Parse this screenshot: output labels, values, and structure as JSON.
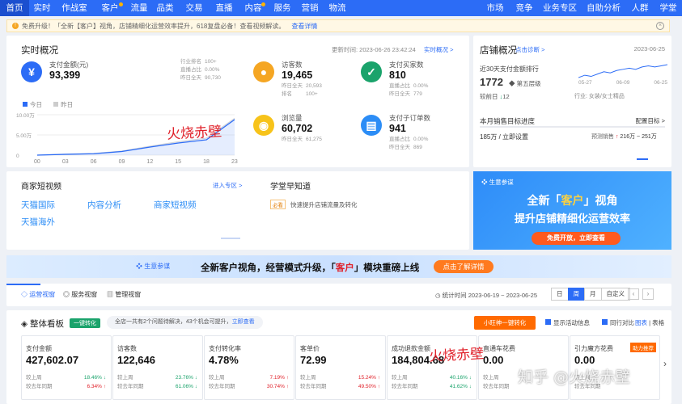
{
  "nav": {
    "items": [
      {
        "label": "首页",
        "dot": false
      },
      {
        "label": "实时",
        "dot": false
      },
      {
        "label": "作战室",
        "dot": false
      },
      {
        "label": "客户",
        "dot": true
      },
      {
        "label": "流量",
        "dot": false
      },
      {
        "label": "品类",
        "dot": false
      },
      {
        "label": "交易",
        "dot": false
      },
      {
        "label": "直播",
        "dot": false
      },
      {
        "label": "内容",
        "dot": true
      },
      {
        "label": "服务",
        "dot": false
      },
      {
        "label": "营销",
        "dot": false
      },
      {
        "label": "物流",
        "dot": false
      },
      {
        "label": "市场",
        "dot": false
      },
      {
        "label": "竞争",
        "dot": false
      },
      {
        "label": "业务专区",
        "dot": false
      },
      {
        "label": "自助分析",
        "dot": false
      },
      {
        "label": "人群",
        "dot": false
      },
      {
        "label": "学堂",
        "dot": false
      }
    ]
  },
  "alert": {
    "icon": "!",
    "text": "免费升级！「全新【客户】视角，店铺精细化运营效率提升，618复盘必备！查看视频解读。",
    "link": "查看详情",
    "close": "×"
  },
  "realtime": {
    "title": "实时概况",
    "update_time": "更新时间: 2023-06-26 23:42:24",
    "link": "实时概况 >",
    "metrics": [
      {
        "icon": "¥",
        "label": "支付金额(元)",
        "value": "93,399",
        "color": "#2c6cf6",
        "rows": [
          [
            "行业排名",
            "100+"
          ],
          [
            "直播占比",
            "0.00%"
          ],
          [
            "昨日全天",
            "90,730"
          ]
        ]
      },
      {
        "icon": "●",
        "label": "访客数",
        "value": "19,465",
        "color": "#f5a623",
        "rows": [
          [
            "昨日全天",
            "20,593"
          ],
          [
            "排名",
            "100+"
          ]
        ]
      },
      {
        "icon": "✓",
        "label": "支付买家数",
        "value": "810",
        "color": "#1aa36b",
        "rows": [
          [
            "直播占比",
            "0.00%"
          ],
          [
            "昨日全天",
            "779"
          ]
        ]
      },
      {
        "icon": "◉",
        "label": "浏览量",
        "value": "60,702",
        "color": "#f7c31a",
        "rows": [
          [
            "昨日全天",
            "61,275"
          ]
        ]
      },
      {
        "icon": "▤",
        "label": "支付子订单数",
        "value": "941",
        "color": "#2c8df6",
        "rows": [
          [
            "直播占比",
            "0.00%"
          ],
          [
            "昨日全天",
            "869"
          ]
        ]
      }
    ],
    "legend": {
      "today": "今日",
      "yesterday": "昨日"
    }
  },
  "chart_data": {
    "type": "line",
    "title": "",
    "xlabel": "",
    "ylabel": "",
    "categories": [
      "00",
      "03",
      "06",
      "09",
      "12",
      "15",
      "18",
      "23"
    ],
    "y_ticks": [
      "10.00万",
      "5.00万",
      "0"
    ],
    "ylim": [
      0,
      100000
    ],
    "series": [
      {
        "name": "今日",
        "values": [
          0,
          2000,
          3500,
          9000,
          20000,
          30000,
          38000,
          88000
        ]
      },
      {
        "name": "昨日",
        "values": [
          0,
          2500,
          4000,
          10000,
          22000,
          33000,
          42000,
          91000
        ]
      }
    ]
  },
  "watermark": {
    "text": "火烧赤壁"
  },
  "shop": {
    "title": "店铺概况",
    "link": "点击诊断 >",
    "date": "2023-06-25",
    "rank_label": "近30天支付金额排行",
    "rank_value": "1772",
    "layer": "第五层级",
    "change_label": "较前日",
    "change_value": "12",
    "industry": "行业: 女装/女士精品",
    "sparkline_dates": [
      "05-27",
      "06-09",
      "06-25"
    ],
    "sparkline": [
      20,
      22,
      21,
      23,
      25,
      24,
      26,
      27,
      28,
      27,
      29,
      30,
      29,
      30,
      31
    ],
    "target_label": "本月销售目标进度",
    "target_link": "配置目标 >",
    "target_value": "185万 / 立即设置",
    "forecast_label": "预测销售",
    "forecast_value": "216万 ~ 251万"
  },
  "videos": {
    "title": "商家短视频",
    "link": "进入专区 >",
    "items": [
      "天猫国际",
      "内容分析",
      "商家短视频",
      "天猫海外"
    ]
  },
  "academy": {
    "title": "学堂早知道",
    "badge": "必看",
    "item": "快速提升店铺流量及转化"
  },
  "promo_right": {
    "brand": "生意参谋",
    "line1_a": "全新「",
    "line1_b": "客户",
    "line1_c": "」视角",
    "line2": "提升店铺精细化运营效率",
    "cta": "免费开放，立即查看"
  },
  "mid_banner": {
    "brand": "生意参谋",
    "text_a": "全新客户视角，经营模式升级，「",
    "text_b": "客户",
    "text_c": "」模块重磅上线",
    "cta": "点击了解详情"
  },
  "tabs": {
    "items": [
      "运营视窗",
      "服务视窗",
      "管理视窗"
    ],
    "stat_time": "统计时间 2023-06-19 ~ 2023-06-25",
    "periods": [
      "日",
      "周",
      "月",
      "自定义"
    ],
    "active_period": "周"
  },
  "overview": {
    "title": "整体看板",
    "badge": "一键转化",
    "notice": "全店一共有2个问题待解决，43个机会可提升，",
    "notice_link": "立即查看",
    "cta": "小旺神一键转化",
    "opt1": "显示活动信息",
    "opt2": "同行对比",
    "chart_link": "图表",
    "table_link": "表格"
  },
  "kpis": [
    {
      "label": "支付金额",
      "value": "427,602.07",
      "c1": "较上周",
      "r1": "18.46%",
      "d1": "down",
      "c2": "较去年同期",
      "r2": "6.34%",
      "d2": "up"
    },
    {
      "label": "访客数",
      "value": "122,646",
      "c1": "较上周",
      "r1": "23.76%",
      "d1": "down",
      "c2": "较去年同期",
      "r2": "61.06%",
      "d2": "down"
    },
    {
      "label": "支付转化率",
      "value": "4.78%",
      "c1": "较上周",
      "r1": "7.19%",
      "d1": "up",
      "c2": "较去年同期",
      "r2": "30.74%",
      "d2": "up"
    },
    {
      "label": "客单价",
      "value": "72.99",
      "c1": "较上周",
      "r1": "15.24%",
      "d1": "up",
      "c2": "较去年同期",
      "r2": "49.50%",
      "d2": "up"
    },
    {
      "label": "成功退款金额",
      "value": "184,804.68",
      "c1": "较上周",
      "r1": "40.16%",
      "d1": "down",
      "c2": "较去年同期",
      "r2": "41.62%",
      "d2": "down"
    },
    {
      "label": "直通车花费",
      "value": "0.00",
      "c1": "较上周",
      "r1": "",
      "d1": "",
      "c2": "较去年同期",
      "r2": "",
      "d2": ""
    },
    {
      "label": "引力魔方花费",
      "value": "0.00",
      "c1": "较上周",
      "r1": "",
      "d1": "",
      "c2": "较去年同期",
      "r2": "",
      "d2": "",
      "badge": "助力推荐"
    }
  ],
  "footer_watermark": "知乎 @火烧赤壁"
}
